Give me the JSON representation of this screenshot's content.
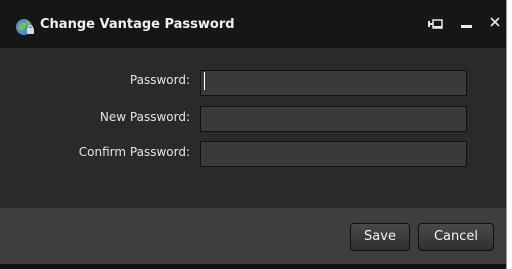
{
  "window": {
    "title": "Change Vantage Password"
  },
  "titlebar_buttons": {
    "pin_icon": "pin-icon",
    "minimize_icon": "minimize-icon",
    "close_icon": "close-icon"
  },
  "form": {
    "password_label": "Password:",
    "password_value": "",
    "new_password_label": "New Password:",
    "new_password_value": "",
    "confirm_password_label": "Confirm Password:",
    "confirm_password_value": ""
  },
  "footer": {
    "save_label": "Save",
    "cancel_label": "Cancel"
  },
  "colors": {
    "background": "#2a2a2a",
    "titlebar": "#161616",
    "footer": "#3e3e3e",
    "field": "#3a3a3a",
    "text": "#e4e4e4"
  }
}
